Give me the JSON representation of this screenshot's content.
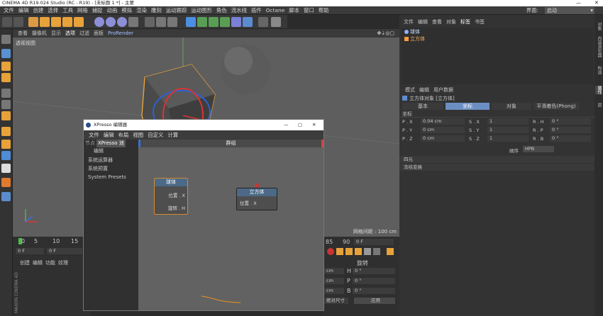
{
  "titlebar": {
    "text": "CINEMA 4D R19.024 Studio (RC - R19) - [未标题 1 *] - 主要",
    "minimize": "—",
    "close": "✕"
  },
  "menubar": {
    "items": [
      "文件",
      "编辑",
      "创建",
      "选择",
      "工具",
      "网格",
      "捕捉",
      "动画",
      "模拟",
      "渲染",
      "雕刻",
      "运动跟踪",
      "运动图形",
      "角色",
      "流水线",
      "插件",
      "Octane",
      "脚本",
      "窗口",
      "帮助"
    ],
    "interface_label": "界面:",
    "interface_value": "启动"
  },
  "viewport": {
    "menu": [
      "查看",
      "摄像机",
      "显示",
      "选项",
      "过滤",
      "面板",
      "ProRender"
    ],
    "label": "透视视图",
    "grid_spacing": "网格间距 : 100 cm"
  },
  "timeline": {
    "ticks": [
      "0",
      "5",
      "10",
      "15"
    ],
    "frame_start": "0 F",
    "frame_end": "0 F"
  },
  "material_menu": [
    "创建",
    "编辑",
    "功能",
    "纹理"
  ],
  "object_manager": {
    "menu": [
      "文件",
      "编辑",
      "查看",
      "对象",
      "标签",
      "书签"
    ],
    "objects": [
      {
        "name": "球体",
        "color": "#8fb3ff"
      },
      {
        "name": "立方体",
        "color": "#ff9d3a"
      }
    ]
  },
  "attributes": {
    "menu": [
      "模式",
      "编辑",
      "用户数据"
    ],
    "title": "立方体对象 [立方体]",
    "tabs": [
      "基本",
      "坐标",
      "对象",
      "平滑着色(Phong)"
    ],
    "active_tab": "坐标",
    "section": "坐标",
    "pos": [
      {
        "label": "P . X",
        "value": "0.04 cm"
      },
      {
        "label": "P . Y",
        "value": "0 cm"
      },
      {
        "label": "P . Z",
        "value": "0 cm"
      }
    ],
    "scale": [
      {
        "label": "S . X",
        "value": "1"
      },
      {
        "label": "S . Y",
        "value": "1"
      },
      {
        "label": "S . Z",
        "value": "1"
      }
    ],
    "rot": [
      {
        "label": "R . H",
        "value": "0 °"
      },
      {
        "label": "R . P",
        "value": "0 °"
      },
      {
        "label": "R . B",
        "value": "0 °"
      }
    ],
    "order_label": "顺序",
    "order_value": "HPB",
    "groups": [
      "四元",
      "冻结变换"
    ]
  },
  "side_tabs": [
    "对象",
    "内容浏览器",
    "构造",
    "属性",
    "层"
  ],
  "xpresso": {
    "title": "XPresso 编辑器",
    "menu": [
      "文件",
      "编辑",
      "布局",
      "视图",
      "自定义",
      "计算"
    ],
    "left_tabs": [
      "节点",
      "XPresso 池"
    ],
    "left_header": "编辑",
    "tree": [
      "系统运算器",
      "系统预置",
      "System Presets"
    ],
    "graph_title": "群组",
    "node_sphere": {
      "title": "球体",
      "ports": [
        "位置 . X",
        "旋转 . H"
      ]
    },
    "node_cube": {
      "title": "立方体",
      "ports": [
        "位置 . X"
      ]
    }
  },
  "coords_panel": {
    "header": "旋转",
    "rows": [
      {
        "unit": "cm",
        "label": "H",
        "value": "0 °"
      },
      {
        "unit": "cm",
        "label": "P",
        "value": "0 °"
      },
      {
        "unit": "cm",
        "label": "B",
        "value": "0 °"
      }
    ],
    "size_label": "绝对尺寸",
    "apply": "应用",
    "ruler": [
      "85",
      "90"
    ],
    "frame": "0 F"
  },
  "colors": {
    "accent": "#6d9ee6",
    "tab_active": "#6b8fc2",
    "wire": "#d68a2a"
  }
}
